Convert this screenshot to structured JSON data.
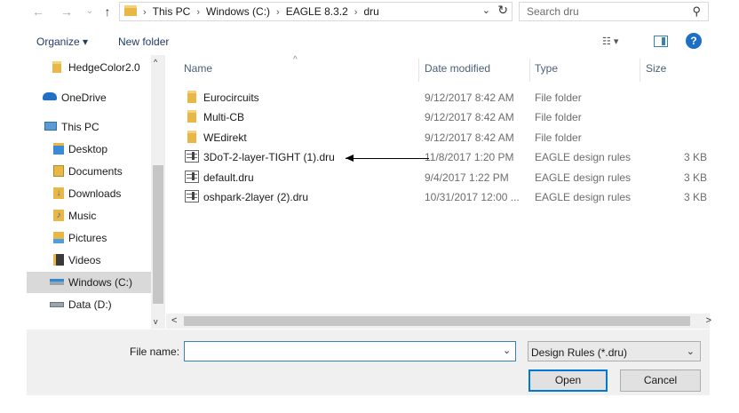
{
  "address": {
    "breadcrumbs": [
      "This PC",
      "Windows (C:)",
      "EAGLE 8.3.2",
      "dru"
    ],
    "search_placeholder": "Search dru"
  },
  "toolbar": {
    "organize_label": "Organize ▾",
    "new_folder_label": "New folder"
  },
  "nav": {
    "items": [
      {
        "label": "HedgeColor2.0",
        "icon": "folder-icon"
      },
      {
        "label": "OneDrive",
        "icon": "cloud-icon"
      },
      {
        "label": "This PC",
        "icon": "computer-icon"
      },
      {
        "label": "Desktop",
        "icon": "folder-icon"
      },
      {
        "label": "Documents",
        "icon": "documents-icon"
      },
      {
        "label": "Downloads",
        "icon": "download-icon"
      },
      {
        "label": "Music",
        "icon": "music-icon"
      },
      {
        "label": "Pictures",
        "icon": "pictures-icon"
      },
      {
        "label": "Videos",
        "icon": "videos-icon"
      },
      {
        "label": "Windows (C:)",
        "icon": "drive-icon",
        "selected": true
      },
      {
        "label": "Data (D:)",
        "icon": "drive-icon"
      }
    ]
  },
  "columns": {
    "name": "Name",
    "date": "Date modified",
    "type": "Type",
    "size": "Size"
  },
  "files": [
    {
      "name": "Eurocircuits",
      "date": "9/12/2017 8:42 AM",
      "type": "File folder",
      "size": "",
      "icon": "folder-icon"
    },
    {
      "name": "Multi-CB",
      "date": "9/12/2017 8:42 AM",
      "type": "File folder",
      "size": "",
      "icon": "folder-icon"
    },
    {
      "name": "WEdirekt",
      "date": "9/12/2017 8:42 AM",
      "type": "File folder",
      "size": "",
      "icon": "folder-icon"
    },
    {
      "name": "3DoT-2-layer-TIGHT (1).dru",
      "date": "11/8/2017 1:20 PM",
      "type": "EAGLE design rules",
      "size": "3 KB",
      "icon": "dru-file-icon"
    },
    {
      "name": "default.dru",
      "date": "9/4/2017 1:22 PM",
      "type": "EAGLE design rules",
      "size": "3 KB",
      "icon": "dru-file-icon"
    },
    {
      "name": "oshpark-2layer (2).dru",
      "date": "10/31/2017 12:00 ...",
      "type": "EAGLE design rules",
      "size": "3 KB",
      "icon": "dru-file-icon"
    }
  ],
  "footer": {
    "file_name_label": "File name:",
    "file_name_value": "",
    "filter_value": "Design Rules (*.dru)",
    "open_label": "Open",
    "cancel_label": "Cancel"
  },
  "colors": {
    "accent": "#0078d7",
    "selected_bg": "#d9d9d9",
    "folder": "#e8b746"
  }
}
